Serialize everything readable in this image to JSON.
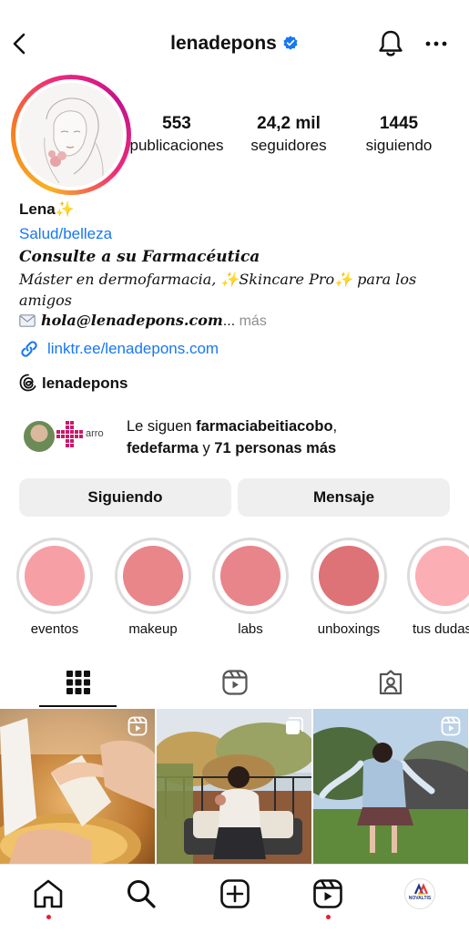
{
  "header": {
    "username": "lenadepons"
  },
  "stats": [
    {
      "value": "553",
      "label": "publicaciones"
    },
    {
      "value": "24,2 mil",
      "label": "seguidores"
    },
    {
      "value": "1445",
      "label": "siguiendo"
    }
  ],
  "bio": {
    "name": "Lena✨",
    "category": "Salud/belleza",
    "line1": "Consulte a su Farmacéutica",
    "line2": "Máster en dermofarmacia, ✨Skincare Pro✨ para los amigos",
    "email": "hola@lenadepons.com",
    "ellipsis": "...",
    "more": "más",
    "link": "linktr.ee/lenadepons.com",
    "threads": "lenadepons"
  },
  "followed_by": {
    "prefix": "Le siguen ",
    "name1": "farmaciabeitiacobo",
    "comma": ",",
    "name2": "fedefarma",
    "middle": " y ",
    "others": "71 personas más",
    "logo_text": "arro"
  },
  "buttons": {
    "following": "Siguiendo",
    "message": "Mensaje"
  },
  "highlights": [
    {
      "label": "eventos",
      "color": "#f6a0a6"
    },
    {
      "label": "makeup",
      "color": "#e8868a"
    },
    {
      "label": "labs",
      "color": "#e8858a"
    },
    {
      "label": "unboxings",
      "color": "#dd7277"
    },
    {
      "label": "tus dudas",
      "color": "#fbaeb3"
    }
  ],
  "tabs": [
    "grid-icon",
    "reels-icon",
    "tagged-icon"
  ],
  "grid_posts": [
    {
      "type": "reel",
      "description_icon": "reels-badge-icon"
    },
    {
      "type": "carousel",
      "description_icon": "carousel-badge-icon"
    },
    {
      "type": "reel",
      "description_icon": "reels-badge-icon"
    }
  ],
  "bottom_nav": {
    "items": [
      "home-icon",
      "search-icon",
      "create-icon",
      "reels-icon",
      "profile-avatar"
    ],
    "profile_avatar_text": "NOVALTIS"
  },
  "colors": {
    "link": "#1877f2",
    "verified": "#1877f2",
    "button_bg": "#efefef",
    "notification_dot": "#ed1b2f"
  }
}
